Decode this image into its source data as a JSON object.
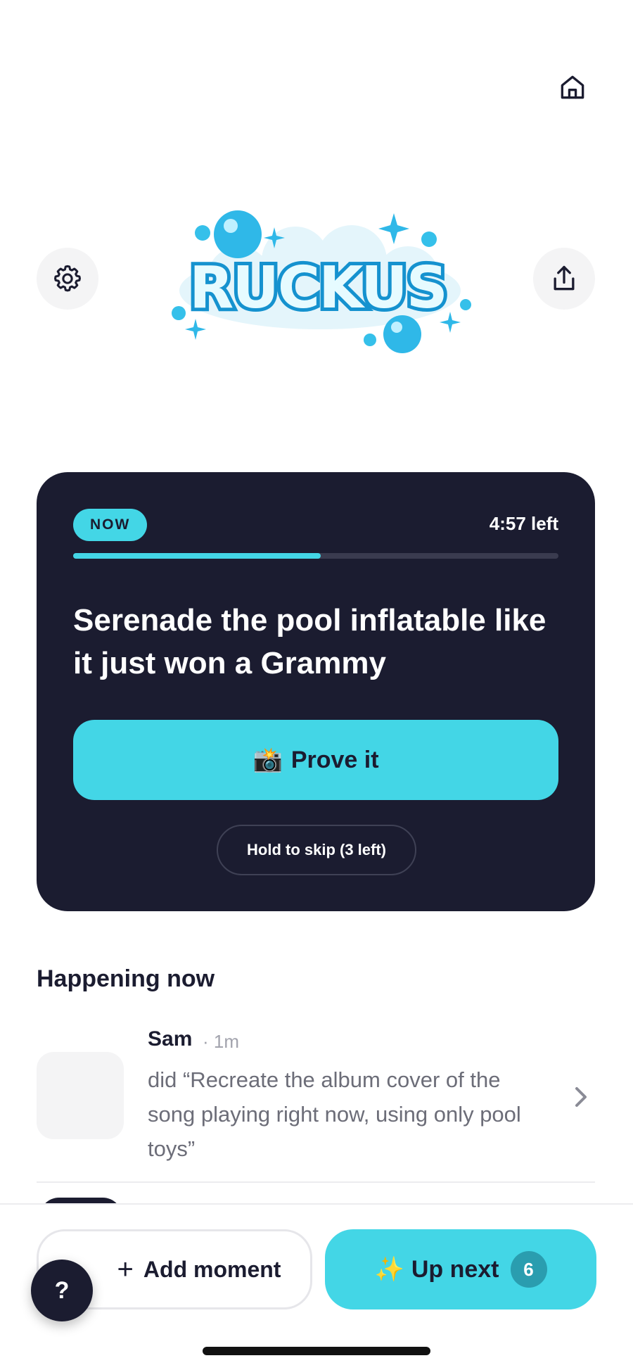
{
  "header": {
    "home_icon": "home-icon",
    "settings_icon": "gear-icon",
    "share_icon": "share-icon",
    "logo_text": "RUCKUS"
  },
  "now_card": {
    "badge": "NOW",
    "time_left": "4:57 left",
    "progress_fraction": 0.51,
    "challenge": "Serenade the pool inflatable like it just won a Grammy",
    "prove_emoji": "📸",
    "prove_label": "Prove it",
    "skip_label": "Hold to skip (3 left)"
  },
  "feed": {
    "title": "Happening now",
    "items": [
      {
        "user": "Sam",
        "time": "· 1m",
        "text": "did “Recreate the album cover of the song playing right now, using only pool toys”"
      }
    ]
  },
  "bottom_bar": {
    "add_plus": "+",
    "add_label": "Add moment",
    "next_emoji": "✨",
    "next_label": "Up next",
    "next_count": "6",
    "help_label": "?"
  },
  "colors": {
    "accent": "#43d6e6",
    "dark": "#1b1c30",
    "muted": "#6c6d78"
  }
}
